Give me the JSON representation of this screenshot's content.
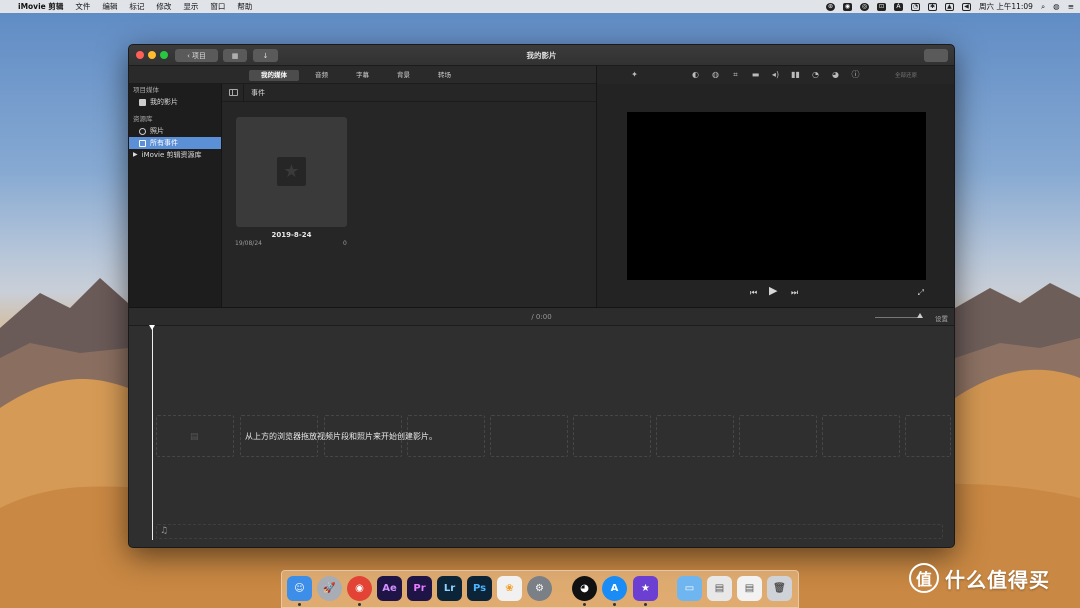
{
  "menubar": {
    "apple": "",
    "items": [
      "iMovie 剪辑",
      "文件",
      "编辑",
      "标记",
      "修改",
      "显示",
      "窗口",
      "帮助"
    ],
    "status_icons": [
      "wechat-icon",
      "record-icon",
      "weibo-icon",
      "baidu-icon",
      "adobe-icon",
      "qq-icon",
      "bluetooth-icon",
      "airplay-icon",
      "volume-icon"
    ],
    "status_glyphs": [
      "⊛",
      "◉",
      "◎",
      "⊡",
      "A",
      "◔",
      "✱",
      "▲",
      "◀"
    ],
    "clock": "周六 上午11:09",
    "search_glyph": "⌕",
    "siri_glyph": "◍",
    "menu_glyph": "≡"
  },
  "window": {
    "title": "我的影片",
    "back_label": "项目",
    "back_glyph": "‹",
    "media_glyph": "▦",
    "import_glyph": "↓"
  },
  "media_tabs": [
    {
      "label": "我的媒体",
      "active": true
    },
    {
      "label": "音频",
      "active": false
    },
    {
      "label": "字幕",
      "active": false
    },
    {
      "label": "背景",
      "active": false
    },
    {
      "label": "转场",
      "active": false
    }
  ],
  "sidebar": {
    "project_section": "项目媒体",
    "project_item": "我的影片",
    "library_section": "资源库",
    "photos_item": "照片",
    "all_events_item": "所有事件",
    "library_item": "iMovie 剪辑资源库",
    "disclosure_glyph": "▶"
  },
  "browser": {
    "header_label": "事件",
    "event": {
      "title": "2019-8-24",
      "date": "19/08/24",
      "count": "0",
      "star_glyph": "★"
    }
  },
  "viewer": {
    "toolbar_glyphs": [
      "✦",
      "◐",
      "◍",
      "⌗",
      "▬",
      "◂)",
      "▮▮",
      "◔",
      "◕",
      "ⓘ"
    ],
    "reset_label": "全部还原",
    "prev_glyph": "⏮",
    "play_glyph": "▶",
    "next_glyph": "⏭",
    "fullscreen_glyph": "⤢"
  },
  "timeline": {
    "time": "/ 0:00",
    "settings_label": "设置",
    "hint": "从上方的浏览器拖放视频片段和照片来开始创建影片。",
    "film_glyph": "▤",
    "note_glyph": "♫"
  },
  "dock": {
    "apps": [
      {
        "name": "finder",
        "label": "☺",
        "color": "#3d8ee8"
      },
      {
        "name": "launchpad",
        "label": "🚀",
        "color": "#a8acb4"
      },
      {
        "name": "chrome",
        "label": "◉",
        "color": "#e24335"
      },
      {
        "name": "after-effects",
        "label": "Ae",
        "color": "#1f1446"
      },
      {
        "name": "premiere",
        "label": "Pr",
        "color": "#1f1446"
      },
      {
        "name": "lightroom",
        "label": "Lr",
        "color": "#0b2438"
      },
      {
        "name": "photoshop",
        "label": "Ps",
        "color": "#0b2438"
      },
      {
        "name": "photos",
        "label": "❀",
        "color": "#f1f1f1"
      },
      {
        "name": "system-preferences",
        "label": "⚙",
        "color": "#7b7f86"
      },
      {
        "name": "qq",
        "label": "◕",
        "color": "#111111"
      },
      {
        "name": "app-store",
        "label": "A",
        "color": "#1a8cf5"
      },
      {
        "name": "imovie",
        "label": "★",
        "color": "#6b3fd1"
      },
      {
        "name": "folder",
        "label": "▭",
        "color": "#6fb6f0"
      },
      {
        "name": "screenshot-1",
        "label": "▤",
        "color": "#e8e8e8"
      },
      {
        "name": "screenshot-2",
        "label": "▤",
        "color": "#f2f2f2"
      },
      {
        "name": "trash",
        "label": "🗑",
        "color": "#cfd3d8"
      }
    ]
  },
  "watermark": {
    "logo_glyph": "值",
    "text": "什么值得买"
  }
}
